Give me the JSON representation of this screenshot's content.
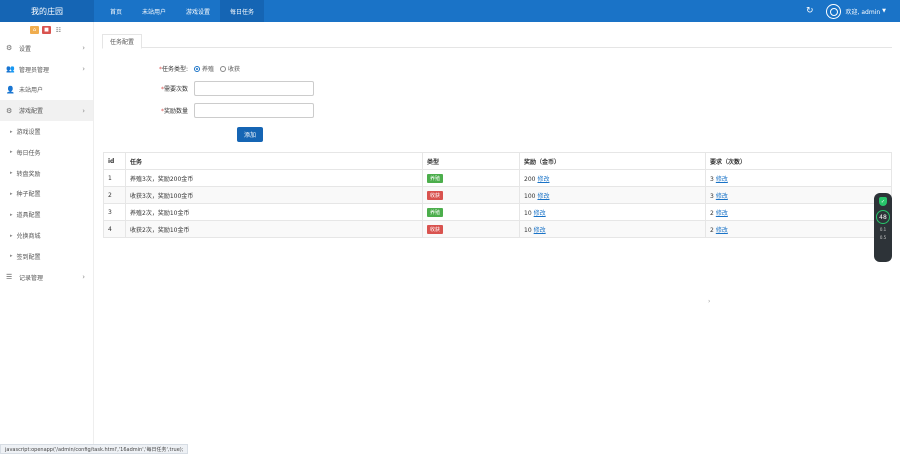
{
  "header": {
    "brand": "我的庄园",
    "nav": [
      "首页",
      "未站用户",
      "游戏设置",
      "每日任务"
    ],
    "active_nav_index": 3,
    "greeting": "欢迎, admin",
    "accent_color": "#1a73c7"
  },
  "sidebar": {
    "items": [
      {
        "label": "设置",
        "icon": "gears-icon",
        "has_chevron": true
      },
      {
        "label": "管理员管理",
        "icon": "users-icon",
        "has_chevron": true
      },
      {
        "label": "未站用户",
        "icon": "user-icon",
        "has_chevron": false
      },
      {
        "label": "游戏配置",
        "icon": "gears-icon",
        "has_chevron": true,
        "active": true
      }
    ],
    "subitems": [
      "游戏设置",
      "每日任务",
      "转盘奖励",
      "种子配置",
      "道具配置",
      "兑换商城",
      "签到配置"
    ],
    "last_item": {
      "label": "记录管理",
      "icon": "list-icon"
    }
  },
  "tab": {
    "label": "任务配置"
  },
  "form": {
    "type_label": "任务类型:",
    "type_options": [
      "养殖",
      "收获"
    ],
    "type_selected": 0,
    "count_label": "需要次数",
    "count_value": "",
    "reward_label": "奖励数量",
    "reward_value": "",
    "add_label": "添加"
  },
  "table": {
    "headers": [
      "id",
      "任务",
      "类型",
      "奖励（金币）",
      "要求（次数）"
    ],
    "edit_label": "修改",
    "rows": [
      {
        "id": "1",
        "task": "养殖3次，奖励200金币",
        "type": "养殖",
        "type_color": "green",
        "reward": "200",
        "req": "3"
      },
      {
        "id": "2",
        "task": "收获3次，奖励100金币",
        "type": "收获",
        "type_color": "red",
        "reward": "100",
        "req": "3"
      },
      {
        "id": "3",
        "task": "养殖2次，奖励10金币",
        "type": "养殖",
        "type_color": "green",
        "reward": "10",
        "req": "2"
      },
      {
        "id": "4",
        "task": "收获2次，奖励10金币",
        "type": "收获",
        "type_color": "red",
        "reward": "10",
        "req": "2"
      }
    ]
  },
  "widget": {
    "value": "48",
    "line1": "0.1",
    "line2": "0.5"
  },
  "status_bar": "javascript:openapp('/admin/config/task.html','16admin','每日任务',true);"
}
